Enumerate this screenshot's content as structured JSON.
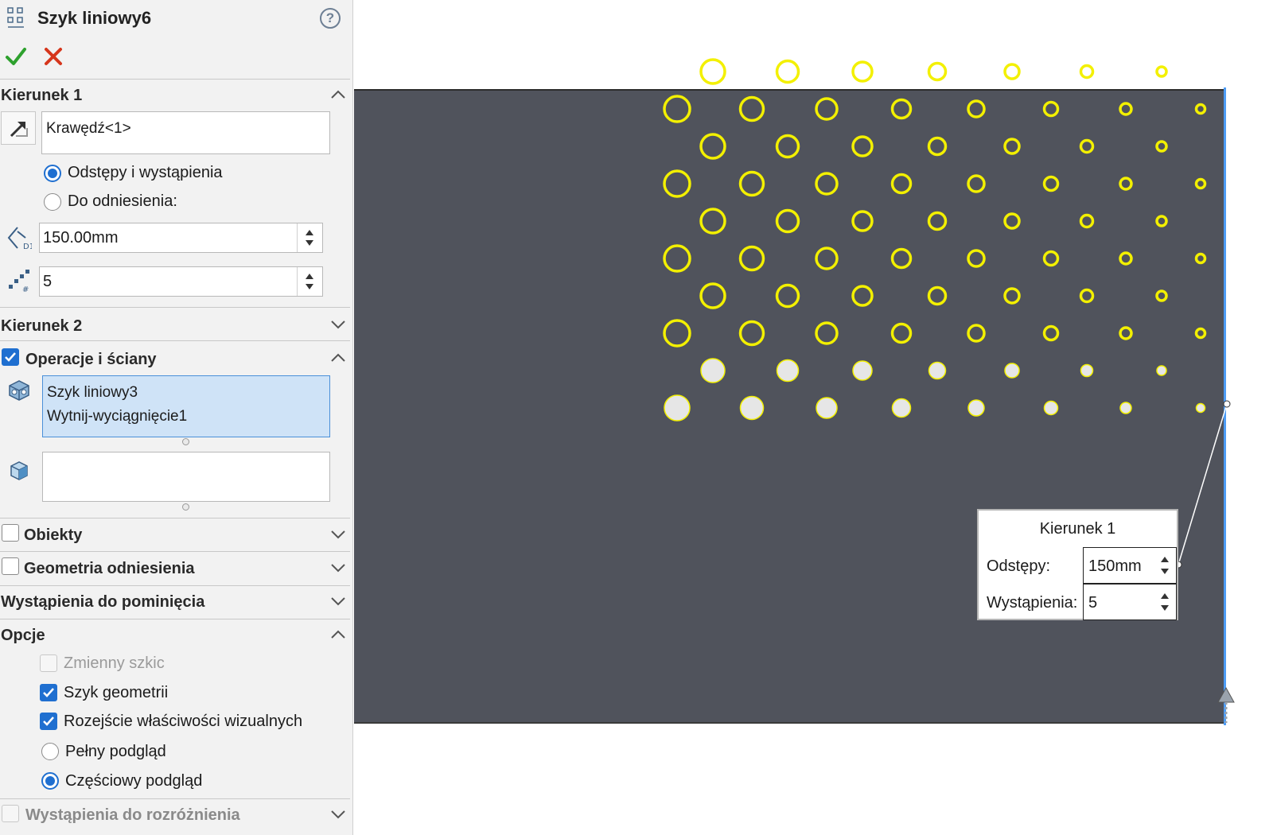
{
  "title": "Szyk liniowy6",
  "icons": {
    "feature": "linear-pattern-icon",
    "help": "help-icon",
    "ok": "checkmark-icon",
    "cancel": "close-icon"
  },
  "help_glyph": "?",
  "direction1": {
    "header": "Kierunek 1",
    "reference": "Krawędź<1>",
    "option_spacing": "Odstępy i wystąpienia",
    "option_reference": "Do odniesienia:",
    "spacing": "150.00mm",
    "instances": "5"
  },
  "direction2": {
    "header": "Kierunek 2"
  },
  "features_faces": {
    "header": "Operacje i ściany",
    "checked": true,
    "items": [
      "Szyk liniowy3",
      "Wytnij-wyciągnięcie1"
    ]
  },
  "bodies": {
    "header": "Obiekty",
    "checked": false
  },
  "ref_geometry": {
    "header": "Geometria odniesienia",
    "checked": false
  },
  "skip_instances": {
    "header": "Wystąpienia do pominięcia"
  },
  "options": {
    "header": "Opcje",
    "vary_sketch": "Zmienny szkic",
    "geometry_pattern": "Szyk geometrii",
    "propagate_visual": "Rozejście właściwości wizualnych",
    "full_preview": "Pełny podgląd",
    "partial_preview": "Częściowy podgląd"
  },
  "instances_to_vary": {
    "header": "Wystąpienia do rozróżnienia"
  },
  "callout": {
    "title": "Kierunek 1",
    "spacing_label": "Odstępy:",
    "spacing_value": "150mm",
    "instances_label": "Wystąpienia:",
    "instances_value": "5"
  },
  "colors": {
    "plate": "#50535c",
    "preview_holes": "#f3f000",
    "existing_holes": "#e6e6e6",
    "edge_selected": "#4d9cf5",
    "accent": "#1f6fd0"
  }
}
